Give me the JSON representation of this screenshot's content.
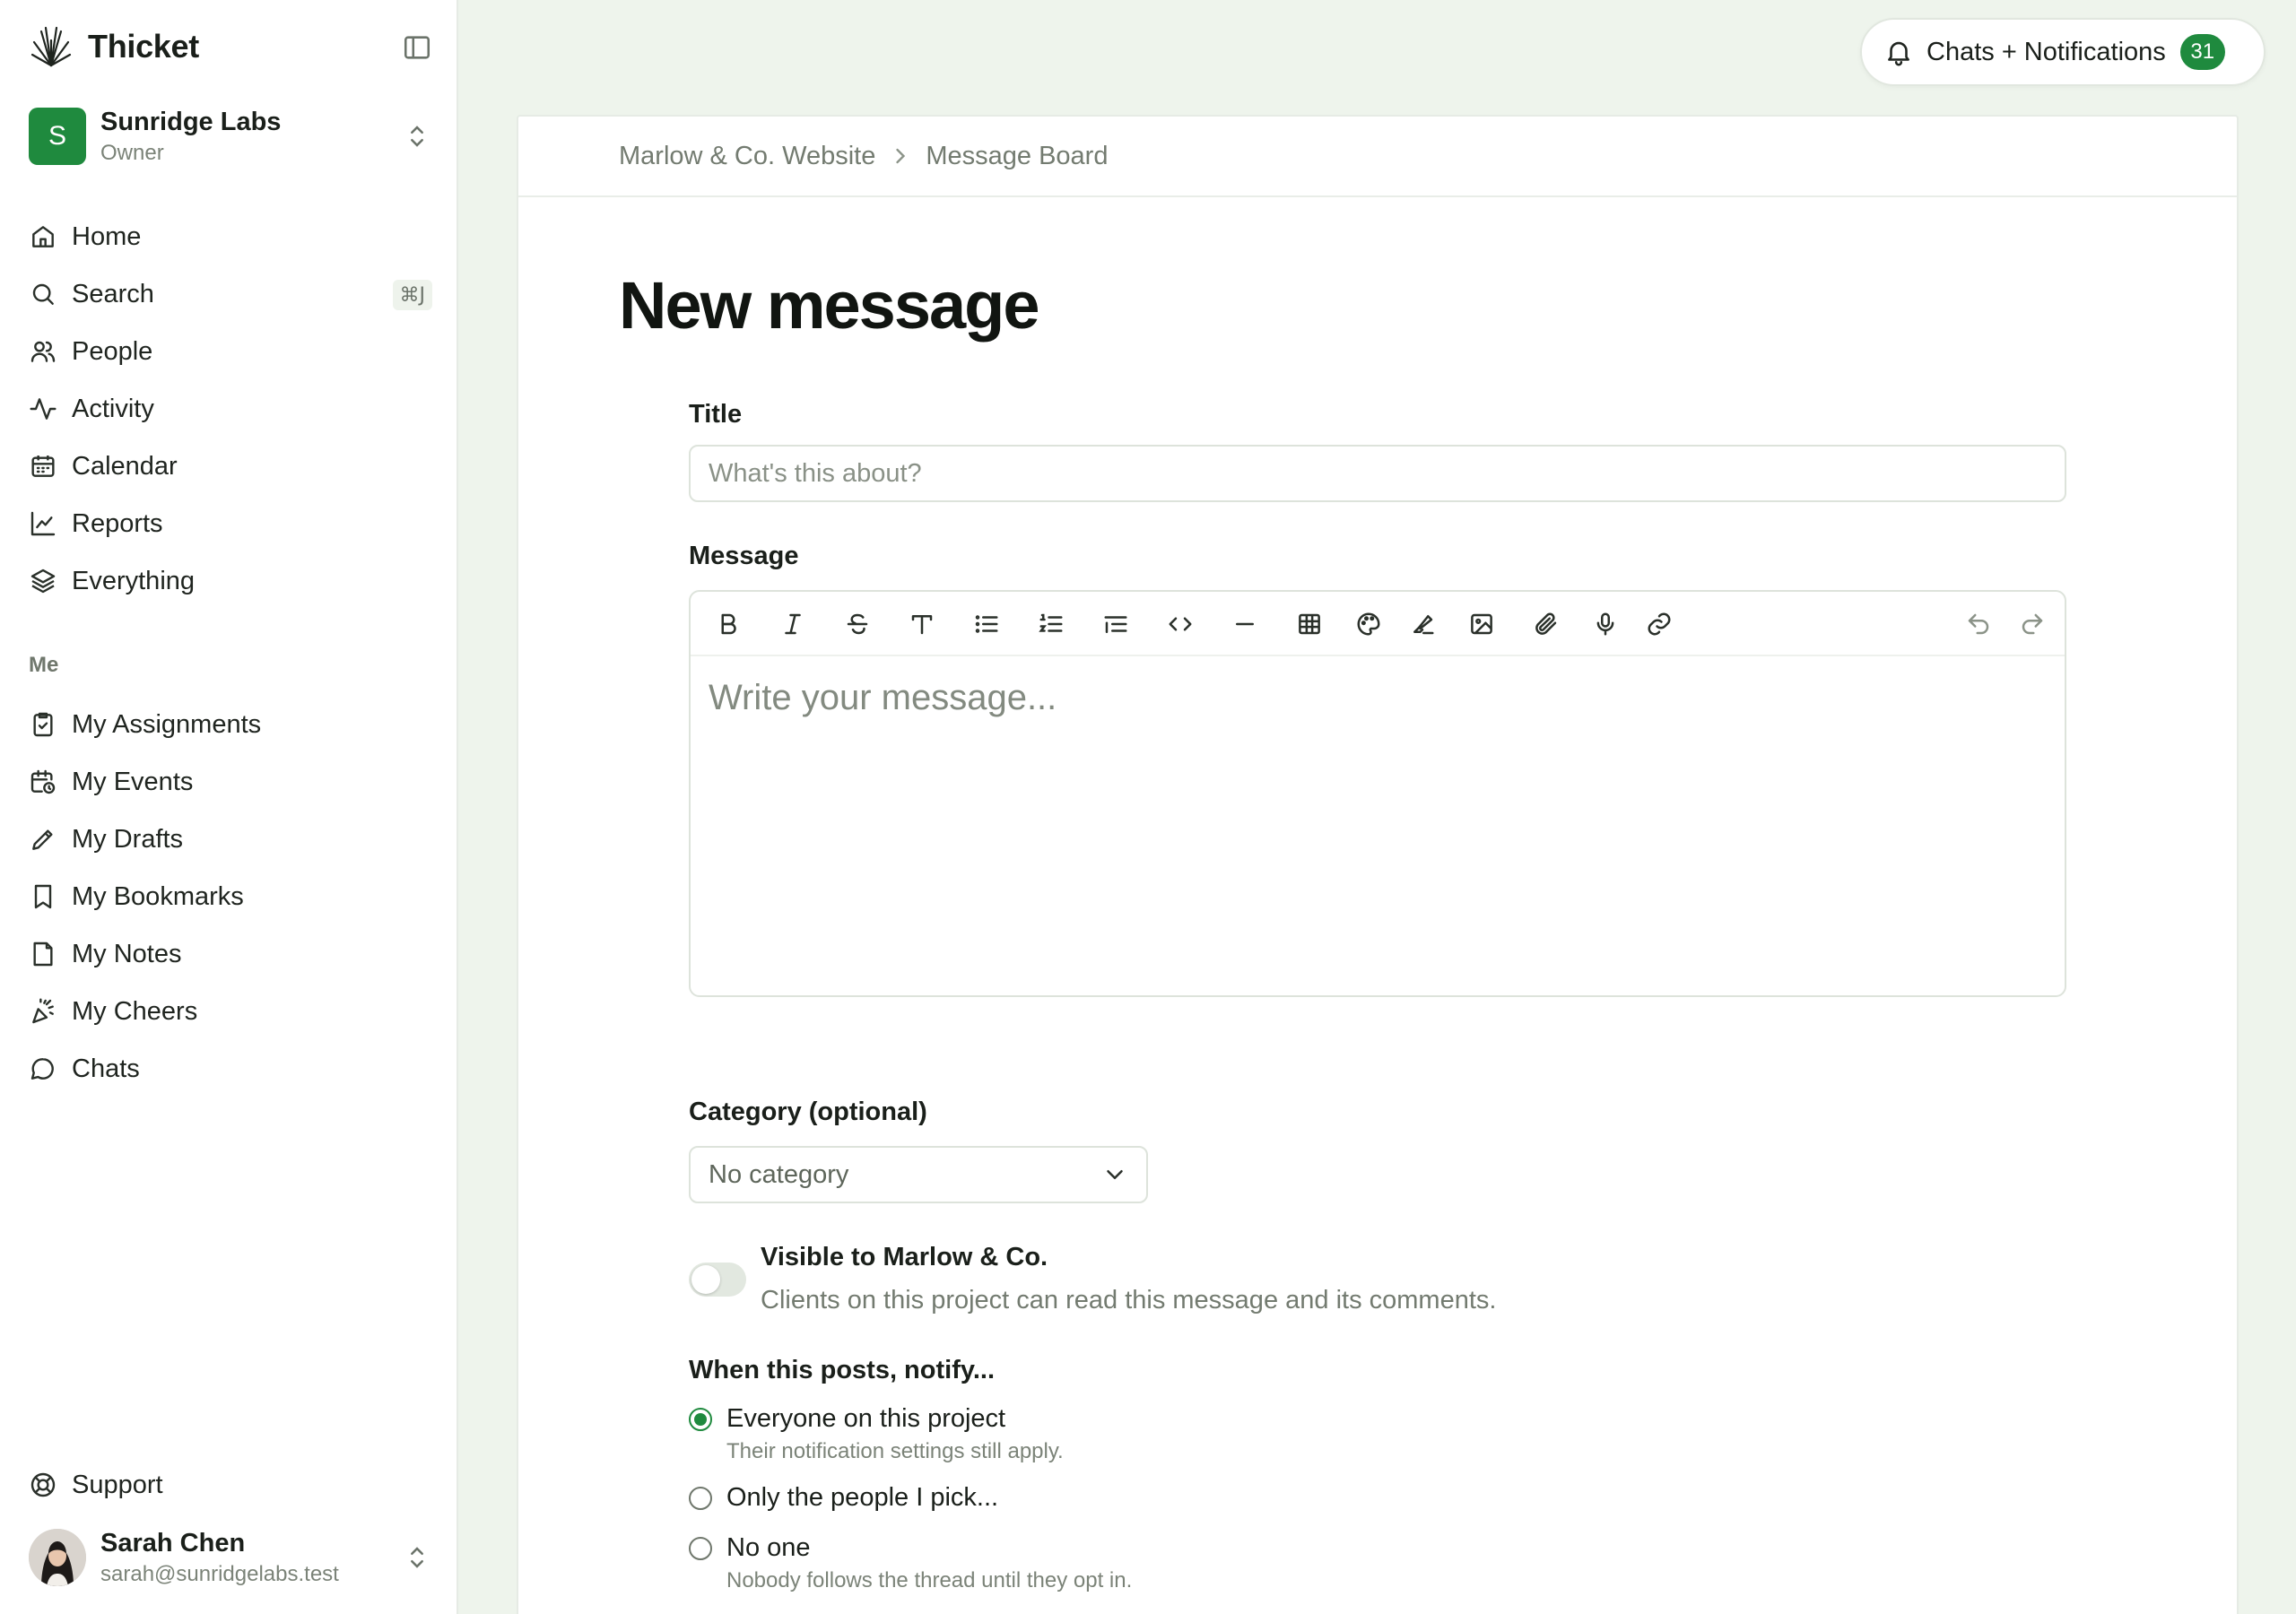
{
  "brand": {
    "name": "Thicket"
  },
  "workspace": {
    "initial": "S",
    "name": "Sunridge Labs",
    "role": "Owner"
  },
  "nav": {
    "items": [
      {
        "label": "Home"
      },
      {
        "label": "Search",
        "shortcut": "⌘J"
      },
      {
        "label": "People"
      },
      {
        "label": "Activity"
      },
      {
        "label": "Calendar"
      },
      {
        "label": "Reports"
      },
      {
        "label": "Everything"
      }
    ],
    "section_me": "Me",
    "me_items": [
      {
        "label": "My Assignments"
      },
      {
        "label": "My Events"
      },
      {
        "label": "My Drafts"
      },
      {
        "label": "My Bookmarks"
      },
      {
        "label": "My Notes"
      },
      {
        "label": "My Cheers"
      },
      {
        "label": "Chats"
      }
    ],
    "support": "Support"
  },
  "user": {
    "name": "Sarah Chen",
    "email": "sarah@sunridgelabs.test"
  },
  "topbar": {
    "notifications_label": "Chats + Notifications",
    "notifications_count": "31"
  },
  "breadcrumb": {
    "project": "Marlow & Co. Website",
    "page": "Message Board"
  },
  "page": {
    "title": "New message"
  },
  "form": {
    "title_label": "Title",
    "title_placeholder": "What's this about?",
    "message_label": "Message",
    "message_placeholder": "Write your message...",
    "toolbar": [
      "bold",
      "italic",
      "strikethrough",
      "heading",
      "bullet-list",
      "numbered-list",
      "quote",
      "code",
      "divider",
      "table",
      "color",
      "highlight",
      "image",
      "attachment",
      "voice",
      "link",
      "undo",
      "redo"
    ],
    "category_label": "Category (optional)",
    "category_value": "No category",
    "visibility_title": "Visible to Marlow & Co.",
    "visibility_desc": "Clients on this project can read this message and its comments.",
    "visibility_on": false,
    "notify_label": "When this posts, notify...",
    "notify_options": [
      {
        "label": "Everyone on this project",
        "help": "Their notification settings still apply.",
        "checked": true
      },
      {
        "label": "Only the people I pick...",
        "help": "",
        "checked": false
      },
      {
        "label": "No one",
        "help": "Nobody follows the thread until they opt in.",
        "checked": false
      }
    ]
  },
  "colors": {
    "accent": "#1f8a3e",
    "background": "#eef4ec"
  }
}
